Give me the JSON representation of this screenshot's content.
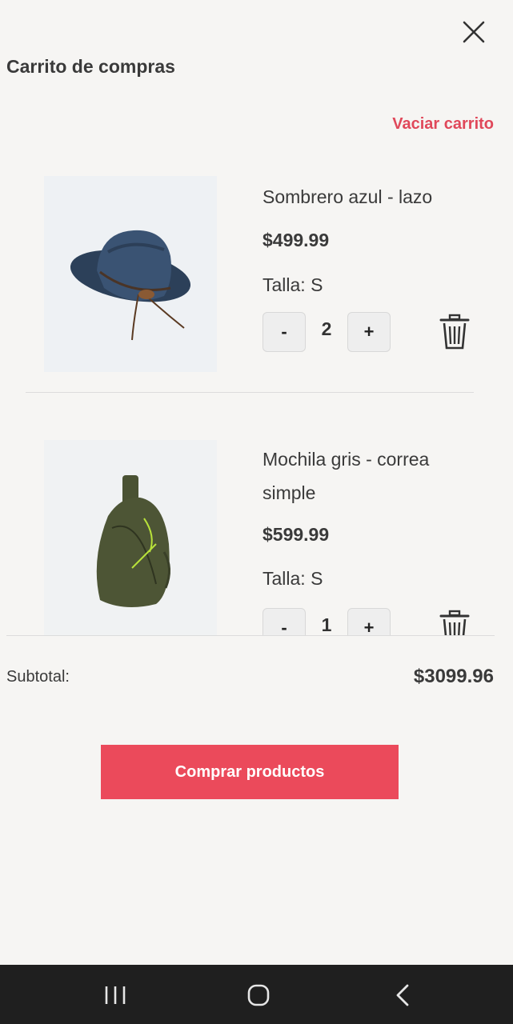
{
  "header": {
    "title": "Carrito de compras",
    "clear_label": "Vaciar carrito"
  },
  "items": [
    {
      "name": "Sombrero azul - lazo",
      "price": "$499.99",
      "size": "Talla: S",
      "quantity": "2",
      "minus": "-",
      "plus": "+"
    },
    {
      "name": "Mochila gris - correa simple",
      "price": "$599.99",
      "size": "Talla: S",
      "quantity": "1",
      "minus": "-",
      "plus": "+"
    }
  ],
  "summary": {
    "subtotal_label": "Subtotal:",
    "subtotal_value": "$3099.96"
  },
  "actions": {
    "buy_label": "Comprar productos"
  },
  "colors": {
    "accent": "#eb4a5b",
    "link": "#e0485a",
    "background": "#f6f5f3",
    "navbar": "#1f1f1f"
  },
  "icons": [
    "close-icon",
    "trash-icon",
    "recent-apps-icon",
    "home-icon",
    "back-icon"
  ]
}
